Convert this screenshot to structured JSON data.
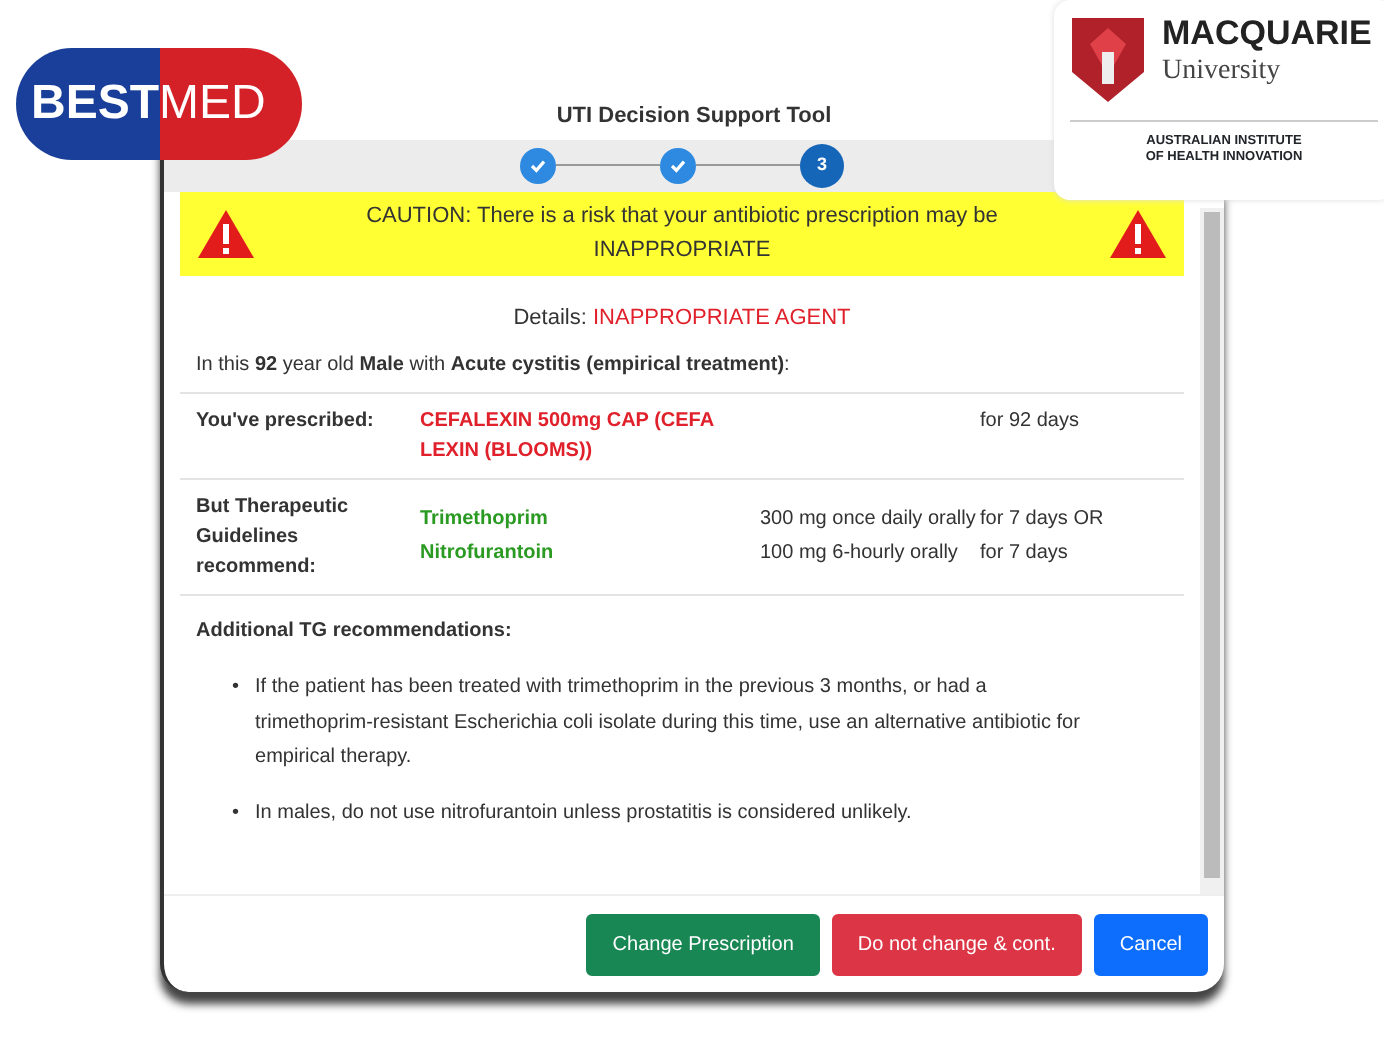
{
  "logos": [
    {
      "kind": "bestmed",
      "parts": [
        "BEST",
        "MED"
      ]
    },
    {
      "kind": "macquarie",
      "lines": [
        "MACQUARIE",
        "University"
      ],
      "institute": [
        "AUSTRALIAN INSTITUTE",
        "OF HEALTH INNOVATION"
      ]
    }
  ],
  "dialog": {
    "title": "UTI Decision Support Tool",
    "steps": [
      {
        "done": true
      },
      {
        "done": true
      },
      {
        "done": false,
        "number": "3"
      }
    ],
    "caution": "CAUTION: There is a risk that your antibiotic prescription may be INAPPROPRIATE",
    "details": {
      "label": "Details:",
      "value": "INAPPROPRIATE AGENT"
    },
    "intro": "In this **92** year old **Male** with **Acute cystitis (empirical treatment)**:",
    "prescribed": {
      "label": "You've prescribed:",
      "drug": "CEFALEXIN 500mg CAP (CEFALEXIN (BLOOMS))",
      "duration": "for 92 days"
    },
    "recommend": {
      "label": "But Therapeutic Guidelines recommend:",
      "options": [
        {
          "drug": "Trimethoprim",
          "dose": "300 mg once daily orally",
          "duration": "for 7 days OR"
        },
        {
          "drug": "Nitrofurantoin",
          "dose": "100 mg 6-hourly orally",
          "duration": "for 7 days"
        }
      ]
    },
    "additional": {
      "title": "Additional TG recommendations:",
      "bullet": "•",
      "items": [
        "If the patient has been treated with trimethoprim in the previous 3 months, or had a trimethoprim-resistant Escherichia coli isolate during this time, use an alternative antibiotic for empirical therapy.",
        "In males, do not use nitrofurantoin unless prostatitis is considered unlikely."
      ]
    },
    "buttons": [
      {
        "label": "Change Prescription",
        "kind": "success"
      },
      {
        "label": "Do not change & cont.",
        "kind": "danger"
      },
      {
        "label": "Cancel",
        "kind": "primary"
      }
    ]
  }
}
